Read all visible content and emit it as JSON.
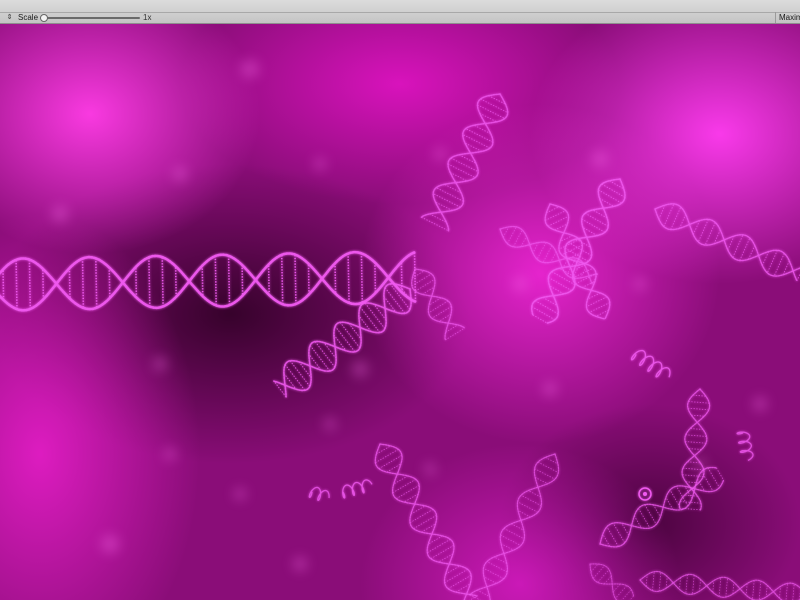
{
  "toolbar": {
    "aspect_icon": "dropdown-arrow",
    "scale_label": "Scale",
    "scale_value": "1x",
    "scale_level": 0,
    "maximize_label": "Maxim"
  },
  "scene": {
    "background_color": "#8a0d78",
    "glow_color": "#ff3ce6",
    "helix_color": "#f05af0"
  }
}
